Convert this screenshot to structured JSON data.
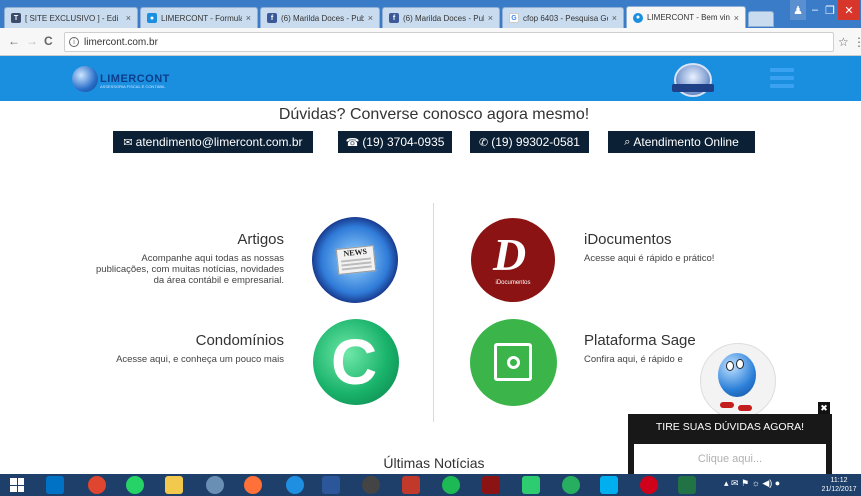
{
  "browser": {
    "tabs": [
      {
        "label": "[ SITE EXCLUSIVO ] - Edi",
        "favicon_color": "#3b4b6b",
        "favicon": "T"
      },
      {
        "label": "LIMERCONT - Formulári",
        "favicon_color": "#1a8fe0",
        "favicon": "●"
      },
      {
        "label": "(6) Marilda Doces - Publ",
        "favicon_color": "#3b5998",
        "favicon": "f"
      },
      {
        "label": "(6) Marilda Doces - Publ",
        "favicon_color": "#3b5998",
        "favicon": "f"
      },
      {
        "label": "cfop 6403 - Pesquisa Go",
        "favicon_color": "#ffffff",
        "favicon": "G"
      },
      {
        "label": "LIMERCONT - Bem vindo",
        "favicon_color": "#1a8fe0",
        "favicon": "●",
        "active": true
      }
    ],
    "url": "limercont.com.br",
    "nav": {
      "back": "←",
      "forward": "→",
      "reload": "C"
    },
    "star": "☆",
    "menu": "⋮"
  },
  "site": {
    "logo_text": "LIMERCONT",
    "logo_sub": "ASSESSORIA FISCAL E CONTÁBIL",
    "contact_heading": "Dúvidas? Converse conosco agora mesmo!",
    "contacts": [
      {
        "icon": "✉",
        "label": "atendimento@limercont.com.br"
      },
      {
        "icon": "☎",
        "label": "(19) 3704-0935"
      },
      {
        "icon": "✆",
        "label": "(19) 99302-0581"
      },
      {
        "icon": "⌕",
        "label": "Atendimento Online"
      }
    ],
    "services": {
      "artigos": {
        "title": "Artigos",
        "desc": [
          "Acompanhe aqui todas as nossas",
          "publicações, com muitas notícias, novidades",
          "da área contábil e empresarial."
        ],
        "badge": "NEWS"
      },
      "idocumentos": {
        "title": "iDocumentos",
        "desc": [
          "Acesse aqui é rápido e prático!"
        ],
        "logo_letter": "D",
        "logo_label": "iDocumentos"
      },
      "condominios": {
        "title": "Condomínios",
        "desc": [
          "Acesse aqui, e conheça um pouco mais"
        ],
        "logo_letter": "C"
      },
      "sage": {
        "title": "Plataforma Sage",
        "desc": [
          "Confira aqui, é rápido e"
        ]
      }
    },
    "chat": {
      "title": "TIRE SUAS DÚVIDAS AGORA!",
      "placeholder": "Clique aqui...",
      "close": "✖"
    },
    "latest_news_heading": "Últimas Notícias"
  },
  "taskbar": {
    "clock_time": "11:12",
    "clock_date": "21/12/2017"
  },
  "colors": {
    "header_blue": "#1a8fe0",
    "contact_btn": "#0b2035",
    "idoc_red": "#8b1313",
    "sage_green": "#3bb54a"
  }
}
